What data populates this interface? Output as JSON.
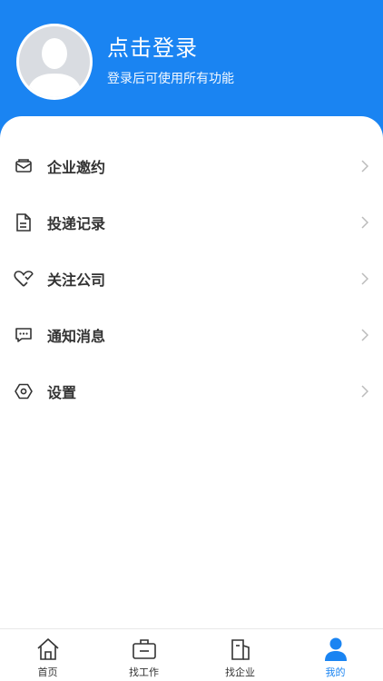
{
  "header": {
    "title": "点击登录",
    "subtitle": "登录后可使用所有功能",
    "bg_color": "#1a84f2"
  },
  "menu": {
    "items": [
      {
        "label": "企业邀约",
        "icon": "envelope-icon"
      },
      {
        "label": "投递记录",
        "icon": "document-icon"
      },
      {
        "label": "关注公司",
        "icon": "heart-check-icon"
      },
      {
        "label": "通知消息",
        "icon": "message-icon"
      },
      {
        "label": "设置",
        "icon": "settings-icon"
      }
    ]
  },
  "tabbar": {
    "active": "我的",
    "active_color": "#1a84f2",
    "tabs": [
      {
        "label": "首页",
        "icon": "home-icon"
      },
      {
        "label": "找工作",
        "icon": "briefcase-icon"
      },
      {
        "label": "找企业",
        "icon": "building-icon"
      },
      {
        "label": "我的",
        "icon": "person-icon"
      }
    ]
  }
}
